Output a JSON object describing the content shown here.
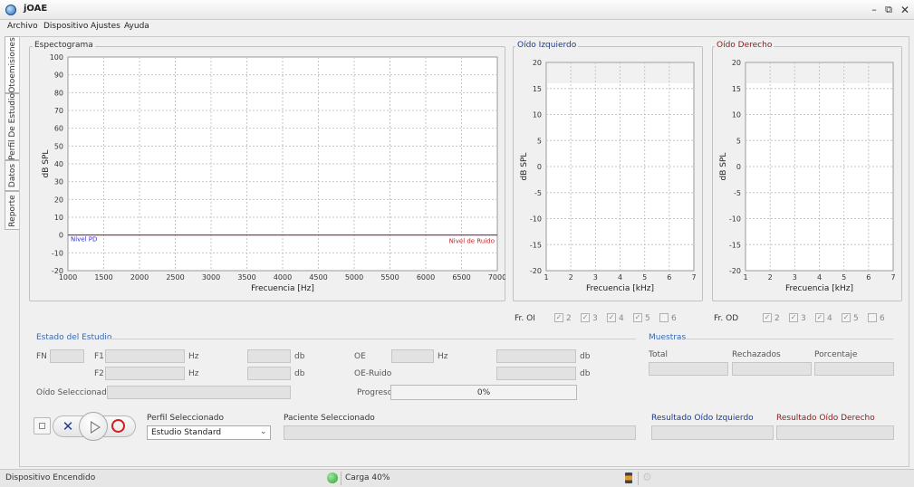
{
  "window": {
    "title": "jOAE"
  },
  "menu": [
    {
      "label": "Archivo"
    },
    {
      "label": "Dispositivo"
    },
    {
      "label": "Ajustes"
    },
    {
      "label": "Ayuda"
    }
  ],
  "tabs": [
    {
      "label": "Otoemisiones"
    },
    {
      "label": "Perfil De Estudio"
    },
    {
      "label": "Datos"
    },
    {
      "label": "Reporte"
    }
  ],
  "charts": {
    "spectrogram": {
      "title": "Espectograma",
      "xlabel": "Frecuencia [Hz]",
      "ylabel": "dB SPL",
      "label_pd": "Nivel PD",
      "label_noise": "Nivel de Ruido",
      "xticks": [
        "1000",
        "1500",
        "2000",
        "2500",
        "3000",
        "3500",
        "4000",
        "4500",
        "5000",
        "5500",
        "6000",
        "6500",
        "7000"
      ],
      "yticks": [
        "100",
        "90",
        "80",
        "70",
        "60",
        "50",
        "40",
        "30",
        "20",
        "10",
        "0",
        "-10",
        "-20"
      ]
    },
    "left_ear": {
      "title": "Oído Izquierdo",
      "xlabel": "Frecuencia [kHz]",
      "ylabel": "dB SPL",
      "xticks": [
        "1",
        "2",
        "3",
        "4",
        "5",
        "6",
        "7"
      ],
      "yticks": [
        "20",
        "15",
        "10",
        "5",
        "0",
        "-5",
        "-10",
        "-15",
        "-20"
      ]
    },
    "right_ear": {
      "title": "Oído Derecho",
      "xlabel": "Frecuencia [kHz]",
      "ylabel": "dB SPL",
      "xticks": [
        "1",
        "2",
        "3",
        "4",
        "5",
        "6",
        "7"
      ],
      "yticks": [
        "20",
        "15",
        "10",
        "5",
        "0",
        "-5",
        "-10",
        "-15",
        "-20"
      ]
    }
  },
  "chart_data": [
    {
      "type": "line",
      "title": "Espectograma",
      "xlabel": "Frecuencia [Hz]",
      "ylabel": "dB SPL",
      "xlim": [
        1000,
        7000
      ],
      "ylim": [
        -20,
        100
      ],
      "grid": true,
      "series": [
        {
          "name": "Nivel PD",
          "color": "#3333cc",
          "x": [
            1000,
            7000
          ],
          "y": [
            0,
            0
          ]
        },
        {
          "name": "Nivel de Ruido",
          "color": "#cc2222",
          "x": [
            1000,
            7000
          ],
          "y": [
            0,
            0
          ]
        }
      ]
    },
    {
      "type": "line",
      "title": "Oído Izquierdo",
      "xlabel": "Frecuencia [kHz]",
      "ylabel": "dB SPL",
      "xlim": [
        1,
        7
      ],
      "ylim": [
        -20,
        20
      ],
      "grid": true,
      "series": []
    },
    {
      "type": "line",
      "title": "Oído Derecho",
      "xlabel": "Frecuencia [kHz]",
      "ylabel": "dB SPL",
      "xlim": [
        1,
        7
      ],
      "ylim": [
        -20,
        20
      ],
      "grid": true,
      "series": []
    }
  ],
  "freq_left": {
    "label": "Fr. OI",
    "options": [
      {
        "label": "2",
        "checked": true
      },
      {
        "label": "3",
        "checked": true
      },
      {
        "label": "4",
        "checked": true
      },
      {
        "label": "5",
        "checked": true
      },
      {
        "label": "6",
        "checked": false
      }
    ]
  },
  "freq_right": {
    "label": "Fr. OD",
    "options": [
      {
        "label": "2",
        "checked": true
      },
      {
        "label": "3",
        "checked": true
      },
      {
        "label": "4",
        "checked": true
      },
      {
        "label": "5",
        "checked": true
      },
      {
        "label": "6",
        "checked": false
      }
    ]
  },
  "study": {
    "legend": "Estado del Estudio",
    "fn": "FN",
    "f1": "F1",
    "f2": "F2",
    "hz": "Hz",
    "db": "db",
    "oe": "OE",
    "oe_noise": "OE-Ruido",
    "selected_ear": "Oído Seleccionado",
    "progress_label": "Progreso",
    "progress_value": "0%",
    "progress_fraction": 0
  },
  "samples": {
    "legend": "Muestras",
    "total": "Total",
    "rejected": "Rechazados",
    "percentage": "Porcentaje"
  },
  "profile": {
    "label": "Perfil Seleccionado",
    "value": "Estudio Standard"
  },
  "patient": {
    "label": "Paciente Seleccionado"
  },
  "results": {
    "left": "Resultado Oído Izquierdo",
    "right": "Resultado Oído Derecho"
  },
  "colors": {
    "left_ear": "#1a3b8f",
    "right_ear": "#8b1a1a",
    "pd_line": "#3333cc",
    "noise_label": "#cc2222",
    "accent": "#3a6ab0",
    "ok_status": "#3cae3c"
  },
  "status": {
    "device": "Dispositivo Encendido",
    "load": "Carga 40%"
  }
}
